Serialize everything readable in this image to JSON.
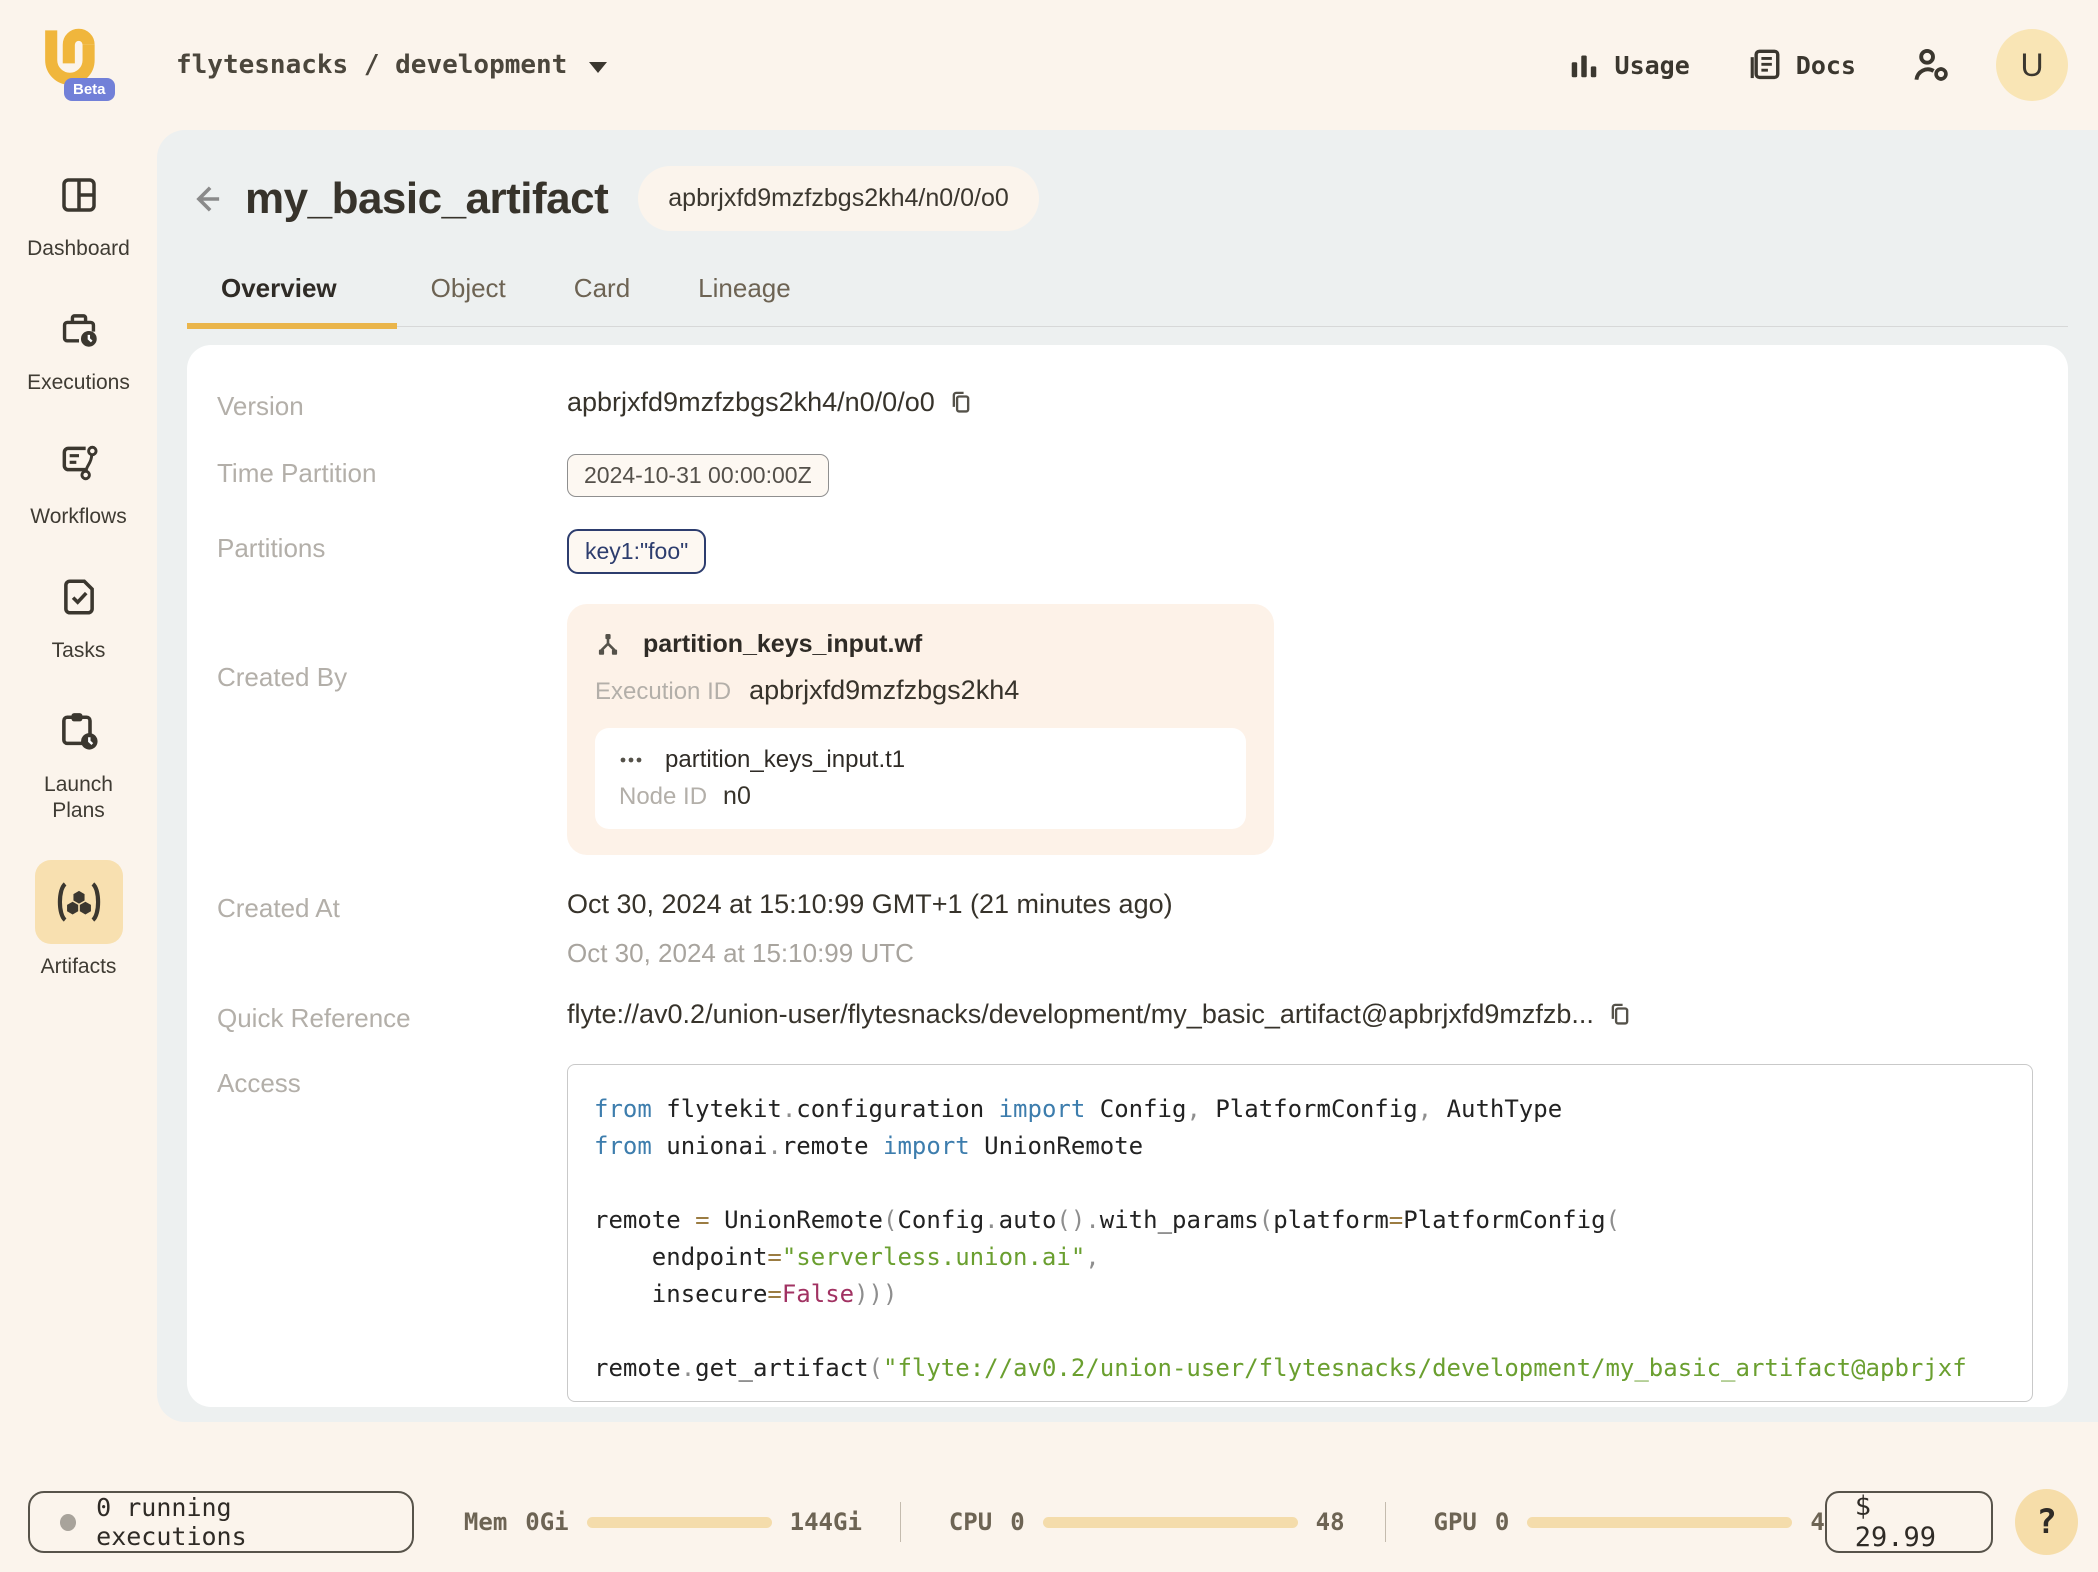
{
  "header": {
    "breadcrumb": "flytesnacks / development",
    "beta_label": "Beta",
    "usage_label": "Usage",
    "docs_label": "Docs",
    "avatar_initial": "U"
  },
  "sidebar": {
    "items": [
      {
        "label": "Dashboard",
        "active": false
      },
      {
        "label": "Executions",
        "active": false
      },
      {
        "label": "Workflows",
        "active": false
      },
      {
        "label": "Tasks",
        "active": false
      },
      {
        "label": "Launch Plans",
        "active": false
      },
      {
        "label": "Artifacts",
        "active": true
      }
    ]
  },
  "artifact": {
    "title": "my_basic_artifact",
    "version_badge": "apbrjxfd9mzfzbgs2kh4/n0/0/o0",
    "tabs": [
      {
        "label": "Overview",
        "active": true
      },
      {
        "label": "Object",
        "active": false
      },
      {
        "label": "Card",
        "active": false
      },
      {
        "label": "Lineage",
        "active": false
      }
    ],
    "fields": {
      "version": {
        "label": "Version",
        "value": "apbrjxfd9mzfzbgs2kh4/n0/0/o0"
      },
      "time_partition": {
        "label": "Time Partition",
        "value": "2024-10-31 00:00:00Z"
      },
      "partitions": {
        "label": "Partitions",
        "value": "key1:\"foo\""
      },
      "created_by": {
        "label": "Created By",
        "workflow_name": "partition_keys_input.wf",
        "execution_id_label": "Execution ID",
        "execution_id": "apbrjxfd9mzfzbgs2kh4",
        "task_name": "partition_keys_input.t1",
        "node_id_label": "Node ID",
        "node_id": "n0"
      },
      "created_at": {
        "label": "Created At",
        "local": "Oct 30, 2024 at 15:10:99 GMT+1 (21 minutes ago)",
        "utc": "Oct 30, 2024 at 15:10:99 UTC"
      },
      "quick_reference": {
        "label": "Quick Reference",
        "value": "flyte://av0.2/union-user/flytesnacks/development/my_basic_artifact@apbrjxfd9mzfzb..."
      },
      "access": {
        "label": "Access"
      }
    },
    "code": {
      "lines": [
        [
          {
            "c": "kw",
            "t": "from "
          },
          {
            "c": "tx",
            "t": "flytekit"
          },
          {
            "c": "pu",
            "t": "."
          },
          {
            "c": "tx",
            "t": "configuration "
          },
          {
            "c": "kw",
            "t": "import "
          },
          {
            "c": "tx",
            "t": "Config"
          },
          {
            "c": "pu",
            "t": ", "
          },
          {
            "c": "tx",
            "t": "PlatformConfig"
          },
          {
            "c": "pu",
            "t": ", "
          },
          {
            "c": "tx",
            "t": "AuthType"
          }
        ],
        [
          {
            "c": "kw",
            "t": "from "
          },
          {
            "c": "tx",
            "t": "unionai"
          },
          {
            "c": "pu",
            "t": "."
          },
          {
            "c": "tx",
            "t": "remote "
          },
          {
            "c": "kw",
            "t": "import "
          },
          {
            "c": "tx",
            "t": "UnionRemote"
          }
        ],
        [],
        [
          {
            "c": "tx",
            "t": "remote "
          },
          {
            "c": "op",
            "t": "= "
          },
          {
            "c": "tx",
            "t": "UnionRemote"
          },
          {
            "c": "pu",
            "t": "("
          },
          {
            "c": "tx",
            "t": "Config"
          },
          {
            "c": "pu",
            "t": "."
          },
          {
            "c": "tx",
            "t": "auto"
          },
          {
            "c": "pu",
            "t": "()."
          },
          {
            "c": "tx",
            "t": "with_params"
          },
          {
            "c": "pu",
            "t": "("
          },
          {
            "c": "tx",
            "t": "platform"
          },
          {
            "c": "op",
            "t": "="
          },
          {
            "c": "tx",
            "t": "PlatformConfig"
          },
          {
            "c": "pu",
            "t": "("
          }
        ],
        [
          {
            "c": "tx",
            "t": "    endpoint"
          },
          {
            "c": "op",
            "t": "="
          },
          {
            "c": "str",
            "t": "\"serverless.union.ai\""
          },
          {
            "c": "pu",
            "t": ","
          }
        ],
        [
          {
            "c": "tx",
            "t": "    insecure"
          },
          {
            "c": "op",
            "t": "="
          },
          {
            "c": "kw2",
            "t": "False"
          },
          {
            "c": "pu",
            "t": ")))"
          }
        ],
        [],
        [
          {
            "c": "tx",
            "t": "remote"
          },
          {
            "c": "pu",
            "t": "."
          },
          {
            "c": "tx",
            "t": "get_artifact"
          },
          {
            "c": "pu",
            "t": "("
          },
          {
            "c": "str",
            "t": "\"flyte://av0.2/union-user/flytesnacks/development/my_basic_artifact@apbrjxf"
          }
        ]
      ]
    }
  },
  "statusbar": {
    "running_executions": "0 running executions",
    "mem": {
      "label": "Mem",
      "current": "0Gi",
      "max": "144Gi"
    },
    "cpu": {
      "label": "CPU",
      "current": "0",
      "max": "48"
    },
    "gpu": {
      "label": "GPU",
      "current": "0",
      "max": "4"
    },
    "cost": "$ 29.99",
    "help": "?"
  },
  "colors": {
    "accent_yellow": "#eab54b",
    "logo_yellow": "#f0b63c",
    "beta_blue": "#7280d8",
    "navy_chip": "#2d3d6e",
    "page_cream": "#fbf4ec",
    "panel_gray": "#edf0f0",
    "peach_card": "#fdf2e8",
    "sidebar_active": "#f8e0b0"
  }
}
